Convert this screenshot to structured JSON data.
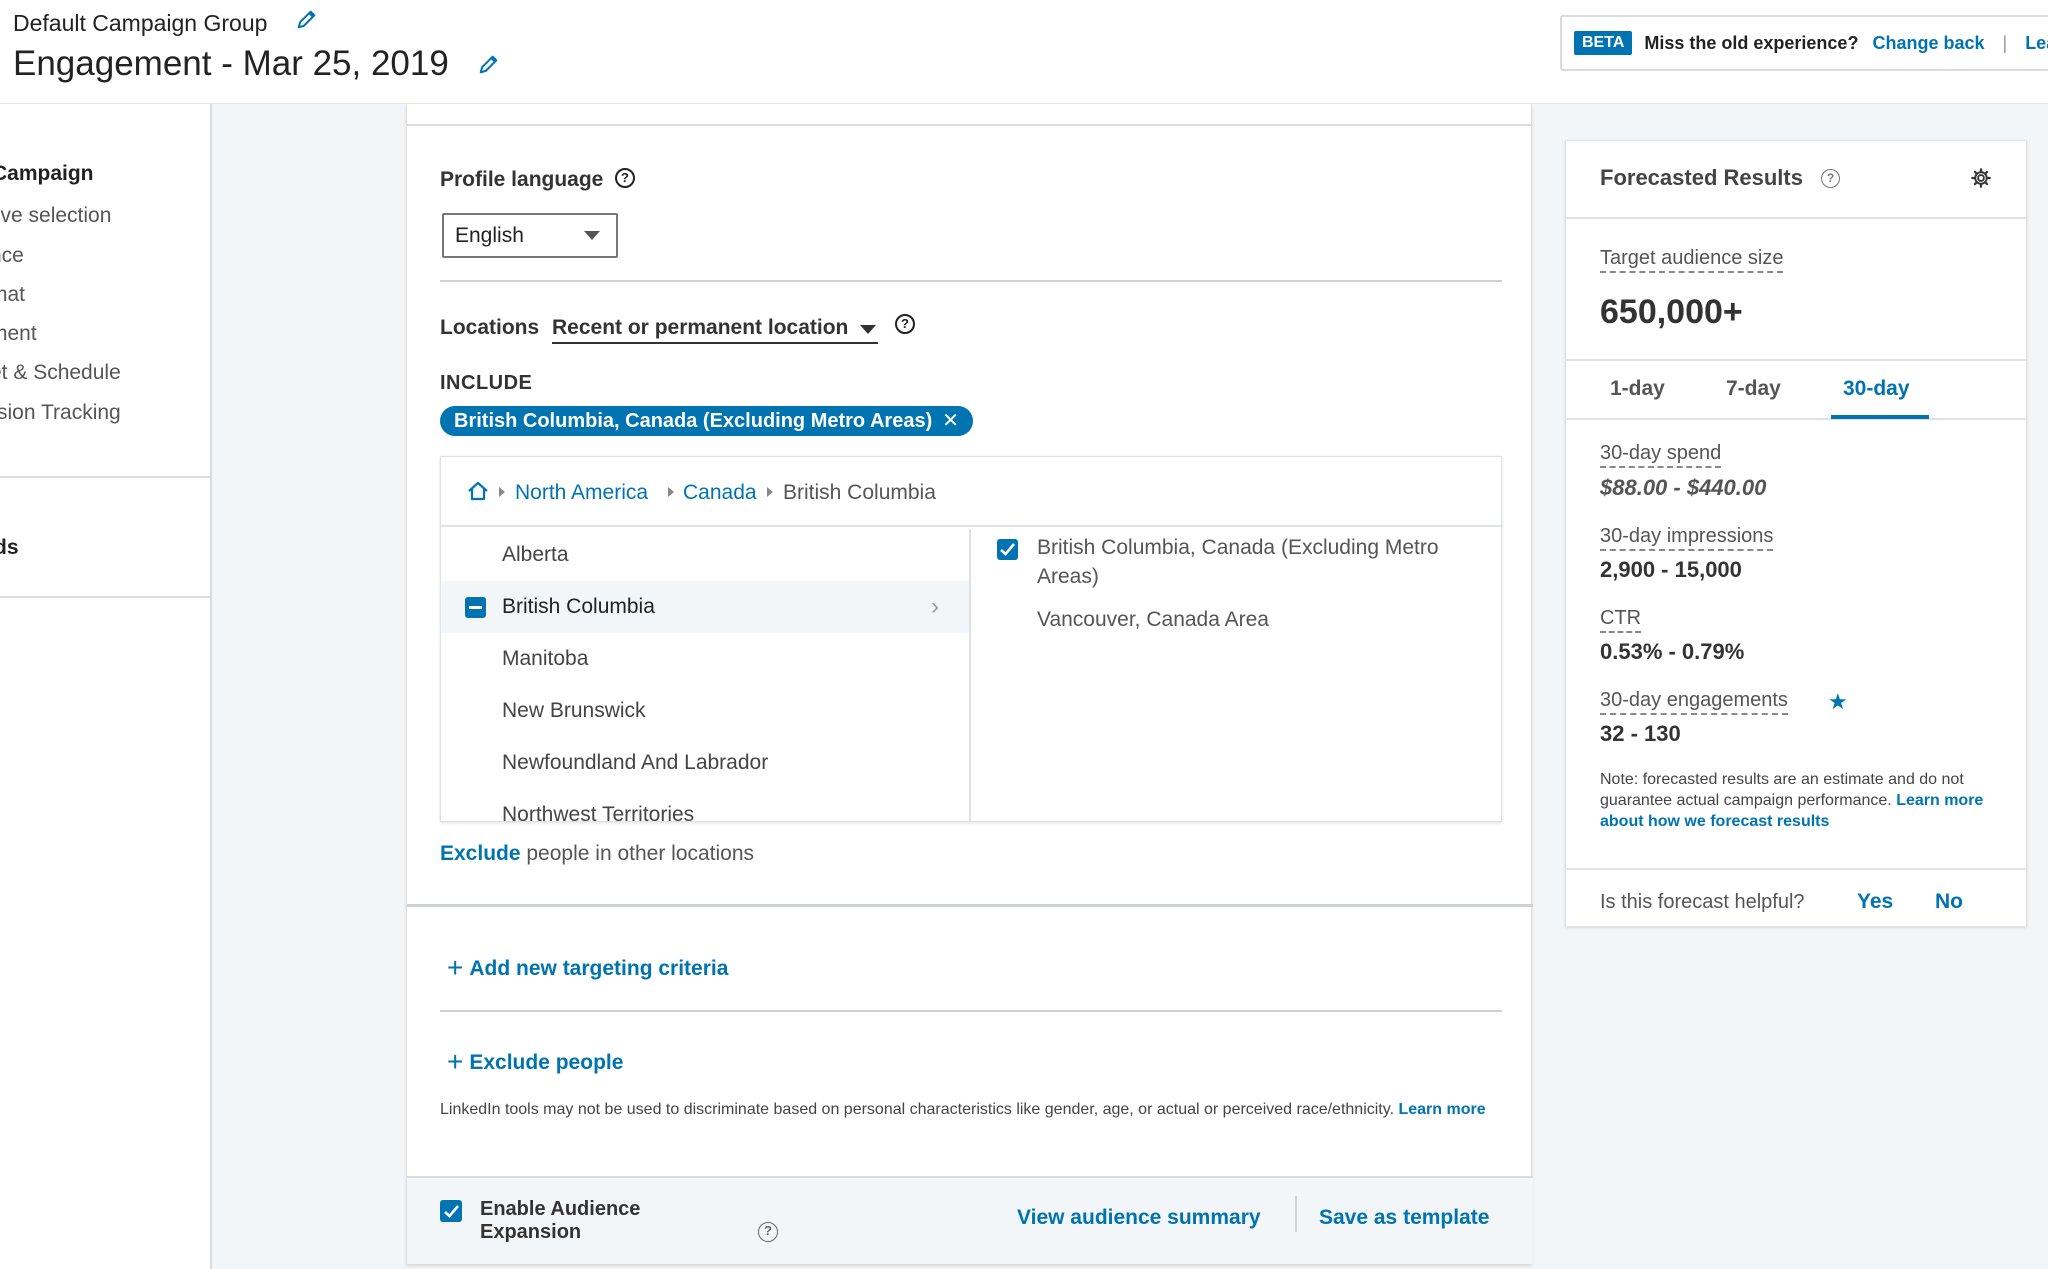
{
  "header": {
    "group_name": "Default Campaign Group",
    "campaign_title": "Engagement - Mar 25, 2019",
    "beta_badge": "BETA",
    "beta_question": "Miss the old experience?",
    "beta_change": "Change back",
    "beta_separator": "|",
    "beta_learn": "Lea"
  },
  "left_nav": {
    "campaign_title": "Campaign",
    "items": [
      "tive selection",
      "nce",
      "mat",
      "ment",
      "et & Schedule",
      "rsion Tracking"
    ],
    "ads_label": "ds"
  },
  "main": {
    "profile_language_label": "Profile language",
    "profile_language_value": "English",
    "locations_label": "Locations",
    "locations_mode": "Recent or permanent location",
    "include_label": "INCLUDE",
    "include_pill": "British Columbia, Canada (Excluding Metro Areas)",
    "pill_close": "✕",
    "breadcrumb": {
      "north_america": "North America",
      "canada": "Canada",
      "british_columbia": "British Columbia"
    },
    "location_list": [
      "Alberta",
      "British Columbia",
      "Manitoba",
      "New Brunswick",
      "Newfoundland And Labrador",
      "Northwest Territories"
    ],
    "selected_locations": [
      "British Columbia, Canada (Excluding Metro Areas)",
      "Vancouver, Canada Area"
    ],
    "exclude_link": "Exclude",
    "exclude_rest": " people in other locations",
    "add_criteria": "Add new targeting criteria",
    "exclude_people": "Exclude people",
    "plus_symbol": "+",
    "disclaimer_text": "LinkedIn tools may not be used to discriminate based on personal characteristics like gender, age, or actual or perceived race/ethnicity. ",
    "disclaimer_link": "Learn more",
    "enable_expansion": "Enable Audience Expansion",
    "view_summary": "View audience summary",
    "save_template": "Save as template"
  },
  "forecast": {
    "title": "Forecasted Results",
    "audience_label": "Target audience size",
    "audience_value": "650,000+",
    "tabs": [
      "1-day",
      "7-day",
      "30-day"
    ],
    "spend_label": "30-day spend",
    "spend_value": "$88.00 - $440.00",
    "impressions_label": "30-day impressions",
    "impressions_value": "2,900 - 15,000",
    "ctr_label": "CTR",
    "ctr_value": "0.53% - 0.79%",
    "engagements_label": "30-day engagements",
    "engagements_value": "32 - 130",
    "note_text": "Note: forecasted results are an estimate and do not guarantee actual campaign performance. ",
    "note_link": "Learn more about how we forecast results",
    "helpful_question": "Is this forecast helpful?",
    "yes": "Yes",
    "no": "No"
  },
  "icons": {
    "edit": "pencil-icon",
    "help": "question-circle-icon",
    "home": "home-icon",
    "settings": "gear-icon",
    "star": "star-icon"
  },
  "colors": {
    "accent": "#0073b1",
    "background": "#f3f6f8"
  }
}
